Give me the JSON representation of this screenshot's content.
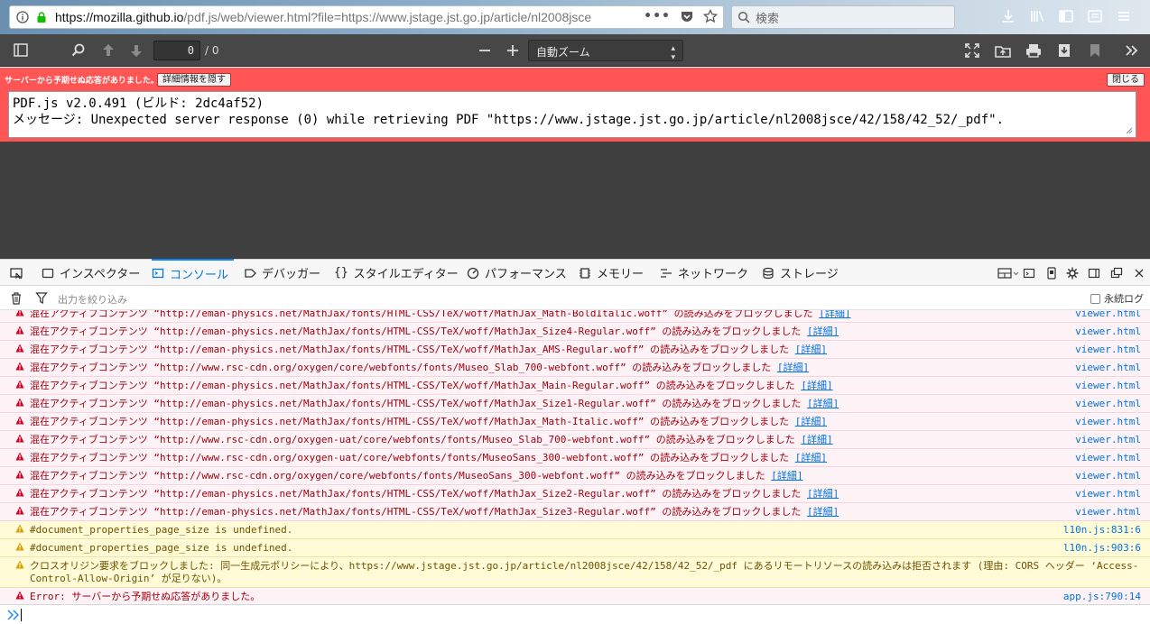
{
  "browser": {
    "url_host": "https://mozilla.github.io",
    "url_rest": "/pdf.js/web/viewer.html?file=https://www.jstage.jst.go.jp/article/nl2008jsce",
    "search_placeholder": "検索"
  },
  "pdf_toolbar": {
    "page_number": "0",
    "page_count": "/ 0",
    "zoom": "自動ズーム"
  },
  "error_bar": {
    "message": "サーバーから予期せぬ応答がありました。",
    "hide_details_label": "詳細情報を隠す",
    "close_label": "閉じる",
    "detail_line1": "PDF.js v2.0.491 (ビルド: 2dc4af52)",
    "detail_line2": "メッセージ: Unexpected server response (0) while retrieving PDF \"https://www.jstage.jst.go.jp/article/nl2008jsce/42/158/42_52/_pdf\"."
  },
  "devtools": {
    "tabs": [
      "インスペクター",
      "コンソール",
      "デバッガー",
      "スタイルエディター",
      "パフォーマンス",
      "メモリー",
      "ネットワーク",
      "ストレージ"
    ],
    "selected_tab": "コンソール",
    "filter_placeholder": "出力を絞り込み",
    "persist_label": "永続ログ"
  },
  "console": {
    "messages": [
      {
        "level": "error",
        "text": "混在アクティブコンテンツ “http://eman-physics.net/MathJax/fonts/HTML-CSS/TeX/woff/MathJax_Math-BoldItalic.woff” の読み込みをブロックしました",
        "link": "[詳細]",
        "source": "viewer.html"
      },
      {
        "level": "error",
        "text": "混在アクティブコンテンツ “http://eman-physics.net/MathJax/fonts/HTML-CSS/TeX/woff/MathJax_Size4-Regular.woff” の読み込みをブロックしました",
        "link": "[詳細]",
        "source": "viewer.html"
      },
      {
        "level": "error",
        "text": "混在アクティブコンテンツ “http://eman-physics.net/MathJax/fonts/HTML-CSS/TeX/woff/MathJax_AMS-Regular.woff” の読み込みをブロックしました",
        "link": "[詳細]",
        "source": "viewer.html"
      },
      {
        "level": "error",
        "text": "混在アクティブコンテンツ “http://www.rsc-cdn.org/oxygen/core/webfonts/fonts/Museo_Slab_700-webfont.woff” の読み込みをブロックしました",
        "link": "[詳細]",
        "source": "viewer.html"
      },
      {
        "level": "error",
        "text": "混在アクティブコンテンツ “http://eman-physics.net/MathJax/fonts/HTML-CSS/TeX/woff/MathJax_Main-Regular.woff” の読み込みをブロックしました",
        "link": "[詳細]",
        "source": "viewer.html"
      },
      {
        "level": "error",
        "text": "混在アクティブコンテンツ “http://eman-physics.net/MathJax/fonts/HTML-CSS/TeX/woff/MathJax_Size1-Regular.woff” の読み込みをブロックしました",
        "link": "[詳細]",
        "source": "viewer.html"
      },
      {
        "level": "error",
        "text": "混在アクティブコンテンツ “http://eman-physics.net/MathJax/fonts/HTML-CSS/TeX/woff/MathJax_Math-Italic.woff” の読み込みをブロックしました",
        "link": "[詳細]",
        "source": "viewer.html"
      },
      {
        "level": "error",
        "text": "混在アクティブコンテンツ “http://www.rsc-cdn.org/oxygen-uat/core/webfonts/fonts/Museo_Slab_700-webfont.woff” の読み込みをブロックしました",
        "link": "[詳細]",
        "source": "viewer.html"
      },
      {
        "level": "error",
        "text": "混在アクティブコンテンツ “http://www.rsc-cdn.org/oxygen-uat/core/webfonts/fonts/MuseoSans_300-webfont.woff” の読み込みをブロックしました",
        "link": "[詳細]",
        "source": "viewer.html"
      },
      {
        "level": "error",
        "text": "混在アクティブコンテンツ “http://www.rsc-cdn.org/oxygen/core/webfonts/fonts/MuseoSans_300-webfont.woff” の読み込みをブロックしました",
        "link": "[詳細]",
        "source": "viewer.html"
      },
      {
        "level": "error",
        "text": "混在アクティブコンテンツ “http://eman-physics.net/MathJax/fonts/HTML-CSS/TeX/woff/MathJax_Size2-Regular.woff” の読み込みをブロックしました",
        "link": "[詳細]",
        "source": "viewer.html"
      },
      {
        "level": "error",
        "text": "混在アクティブコンテンツ “http://eman-physics.net/MathJax/fonts/HTML-CSS/TeX/woff/MathJax_Size3-Regular.woff” の読み込みをブロックしました",
        "link": "[詳細]",
        "source": "viewer.html"
      },
      {
        "level": "warn",
        "text": "#document_properties_page_size is undefined.",
        "link": "",
        "source": "l10n.js:831:6"
      },
      {
        "level": "warn",
        "text": "#document_properties_page_size is undefined.",
        "link": "",
        "source": "l10n.js:903:6"
      },
      {
        "level": "warn",
        "text": "クロスオリジン要求をブロックしました: 同一生成元ポリシーにより、https://www.jstage.jst.go.jp/article/nl2008jsce/42/158/42_52/_pdf にあるリモートリソースの読み込みは拒否されます (理由: CORS ヘッダー ‘Access-\nControl-Allow-Origin’ が足りない)。",
        "link": "",
        "source": ""
      },
      {
        "level": "error",
        "text": "Error: サーバーから予期せぬ応答がありました。",
        "link": "",
        "source": "app.js:790:14"
      }
    ]
  }
}
